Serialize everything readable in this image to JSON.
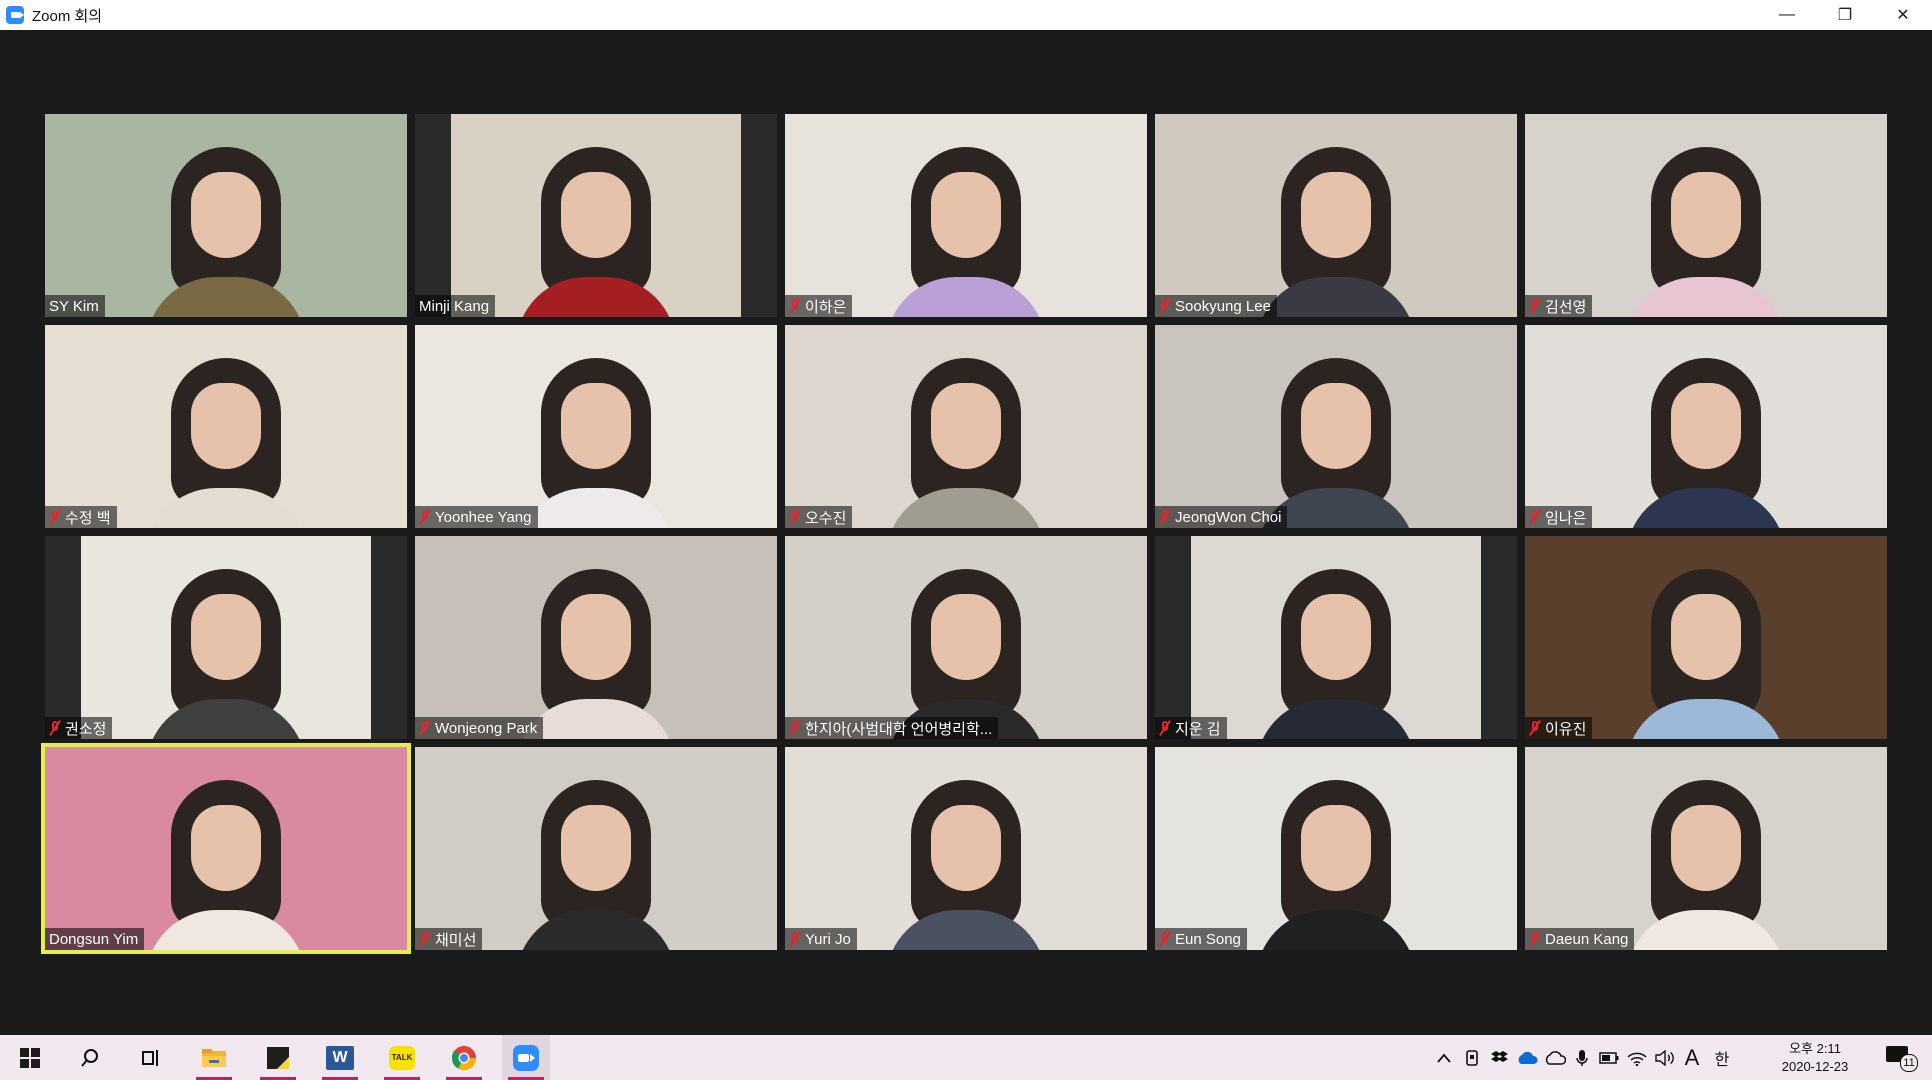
{
  "window": {
    "title": "Zoom 회의",
    "controls": {
      "minimize": "—",
      "maximize": "❐",
      "close": "✕"
    }
  },
  "participants": [
    {
      "name": "SY Kim",
      "muted": false,
      "bg": "#a9b7a2",
      "shirt": "#7a6a44",
      "layout": "full"
    },
    {
      "name": "Minji Kang",
      "muted": false,
      "bg": "#d9d2c4",
      "shirt": "#a51e22",
      "layout": "pillar"
    },
    {
      "name": "이하은",
      "muted": true,
      "bg": "#e8e2dc",
      "shirt": "#b9a0d6",
      "layout": "full"
    },
    {
      "name": "Sookyung Lee",
      "muted": true,
      "bg": "#cfc9c0",
      "shirt": "#3a3a44",
      "layout": "full"
    },
    {
      "name": "김선영",
      "muted": true,
      "bg": "#d8d2cc",
      "shirt": "#e8c6d1",
      "layout": "full"
    },
    {
      "name": "수정 백",
      "muted": true,
      "bg": "#e6ded2",
      "shirt": "#e4dcd0",
      "layout": "full"
    },
    {
      "name": "Yoonhee Yang",
      "muted": true,
      "bg": "#ebe6df",
      "shirt": "#efeaea",
      "layout": "full"
    },
    {
      "name": "오수진",
      "muted": true,
      "bg": "#ddd6cf",
      "shirt": "#a09c92",
      "layout": "full"
    },
    {
      "name": "JeongWon Choi",
      "muted": true,
      "bg": "#c9c4bd",
      "shirt": "#3e4450",
      "layout": "full"
    },
    {
      "name": "임나은",
      "muted": true,
      "bg": "#e1ded9",
      "shirt": "#2c3650",
      "layout": "full"
    },
    {
      "name": "권소정",
      "muted": true,
      "bg": "#e9e6e0",
      "shirt": "#40403e",
      "layout": "pillar"
    },
    {
      "name": "Wonjeong Park",
      "muted": true,
      "bg": "#c7c0b8",
      "shirt": "#e7dcd8",
      "layout": "full"
    },
    {
      "name": "한지아(사범대학 언어병리학...",
      "muted": true,
      "bg": "#d5cfc9",
      "shirt": "#2a2a2a",
      "layout": "full"
    },
    {
      "name": "지운 김",
      "muted": true,
      "bg": "#dcd8d2",
      "shirt": "#252a34",
      "layout": "pillar"
    },
    {
      "name": "이유진",
      "muted": true,
      "bg": "#5a3f2c",
      "shirt": "#9db9d9",
      "layout": "full"
    },
    {
      "name": "Dongsun Yim",
      "muted": false,
      "bg": "#d98aa0",
      "shirt": "#efe8e0",
      "layout": "full",
      "active": true
    },
    {
      "name": "채미선",
      "muted": true,
      "bg": "#d2ccc6",
      "shirt": "#2b2b2b",
      "layout": "full"
    },
    {
      "name": "Yuri Jo",
      "muted": true,
      "bg": "#e2ddd7",
      "shirt": "#4a5262",
      "layout": "full"
    },
    {
      "name": "Eun Song",
      "muted": true,
      "bg": "#e5e3e0",
      "shirt": "#202020",
      "layout": "full"
    },
    {
      "name": "Daeun Kang",
      "muted": true,
      "bg": "#d7d2cc",
      "shirt": "#efe8e2",
      "layout": "full"
    }
  ],
  "taskbar": {
    "apps": [
      "start-icon",
      "search-icon",
      "task-view-icon",
      "file-explorer-icon",
      "sticky-notes-icon",
      "word-icon",
      "kakaotalk-icon",
      "chrome-icon",
      "zoom-icon"
    ],
    "kakao_label": "TALK",
    "word_label": "W",
    "tray_ime": "A",
    "tray_lang": "한",
    "clock_time": "오후 2:11",
    "clock_date": "2020-12-23",
    "notification_count": "11"
  },
  "colors": {
    "meeting_bg": "#1a1a1a",
    "active_speaker": "#e3f04b",
    "muted_icon": "#e0262e",
    "taskbar_bg": "#f1e9ef",
    "taskbar_accent": "#c21f66"
  }
}
